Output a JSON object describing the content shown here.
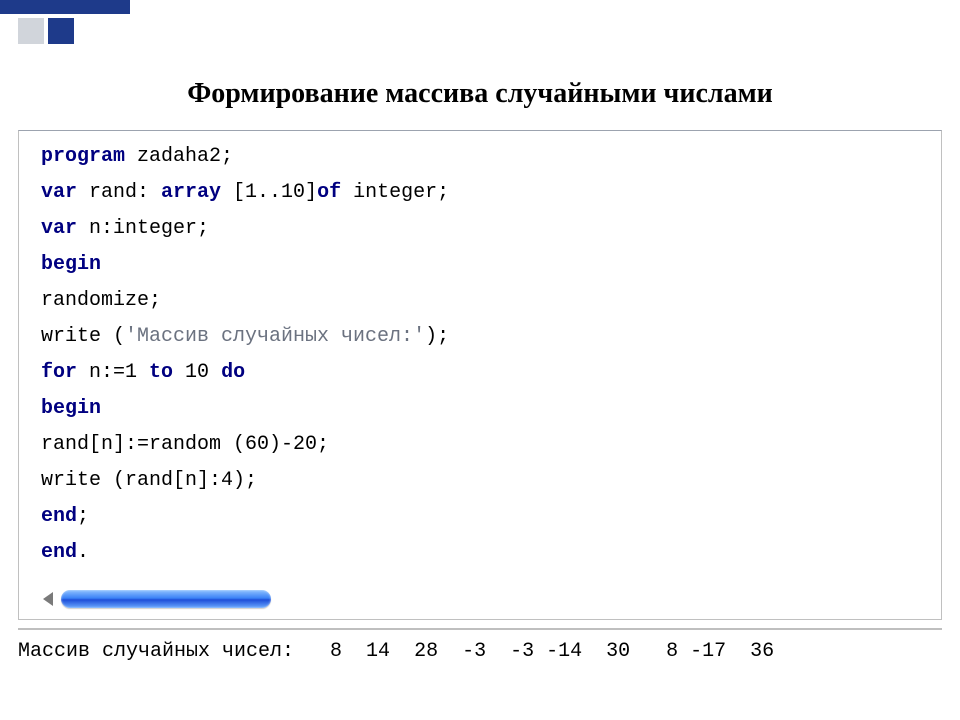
{
  "title": "Формирование массива случайными числами",
  "code": {
    "l1_kw": "program",
    "l1_rest": " zadaha2;",
    "l2_kw1": "var",
    "l2_mid": " rand: ",
    "l2_kw2": "array",
    "l2_mid2": " [1..10]",
    "l2_kw3": "of",
    "l2_rest": " integer;",
    "l3_kw": "var",
    "l3_rest": " n:integer;",
    "l4_kw": "begin",
    "l5": "randomize;",
    "l6_a": "write (",
    "l6_str": "'Массив случайных чисел:'",
    "l6_b": ");",
    "l7_kw1": "for",
    "l7_mid1": " n:=1 ",
    "l7_kw2": "to",
    "l7_mid2": " 10 ",
    "l7_kw3": "do",
    "l8_kw": "begin",
    "l9": "rand[n]:=random (60)-20;",
    "l10": "write (rand[n]:4);",
    "l11_kw": "end",
    "l11_rest": ";",
    "l12_kw": "end",
    "l12_rest": "."
  },
  "output_line": "Массив случайных чисел:   8  14  28  -3  -3 -14  30   8 -17  36"
}
